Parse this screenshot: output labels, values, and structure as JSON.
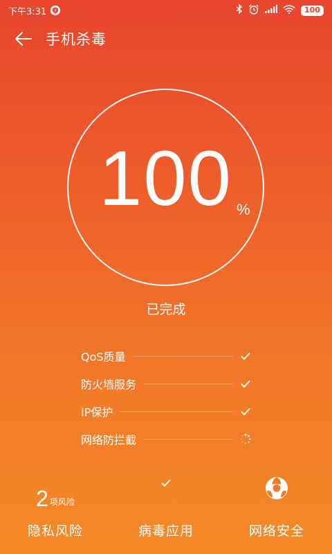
{
  "status_bar": {
    "time": "下午3:31",
    "battery": "100"
  },
  "appbar": {
    "title": "手机杀毒"
  },
  "scan": {
    "value": "100",
    "unit": "%",
    "progress": 100,
    "status": "已完成"
  },
  "checks": [
    {
      "label": "QoS质量",
      "state": "done"
    },
    {
      "label": "防火墙服务",
      "state": "done"
    },
    {
      "label": "IP保护",
      "state": "done"
    },
    {
      "label": "网络防拦截",
      "state": "loading"
    }
  ],
  "bottom": {
    "privacy": {
      "count": "2",
      "unit": "项风险",
      "label": "隐私风险"
    },
    "virus": {
      "label": "病毒应用"
    },
    "network": {
      "label": "网络安全"
    }
  },
  "colors": {
    "gradient_top": "#e8452d",
    "gradient_bottom": "#f58a27"
  },
  "icons": [
    "shield-icon",
    "bluetooth-icon",
    "alarm-icon",
    "signal-icon",
    "wifi-icon",
    "battery-icon",
    "back-arrow-icon",
    "check-icon",
    "loading-icon",
    "network-ball-icon"
  ]
}
